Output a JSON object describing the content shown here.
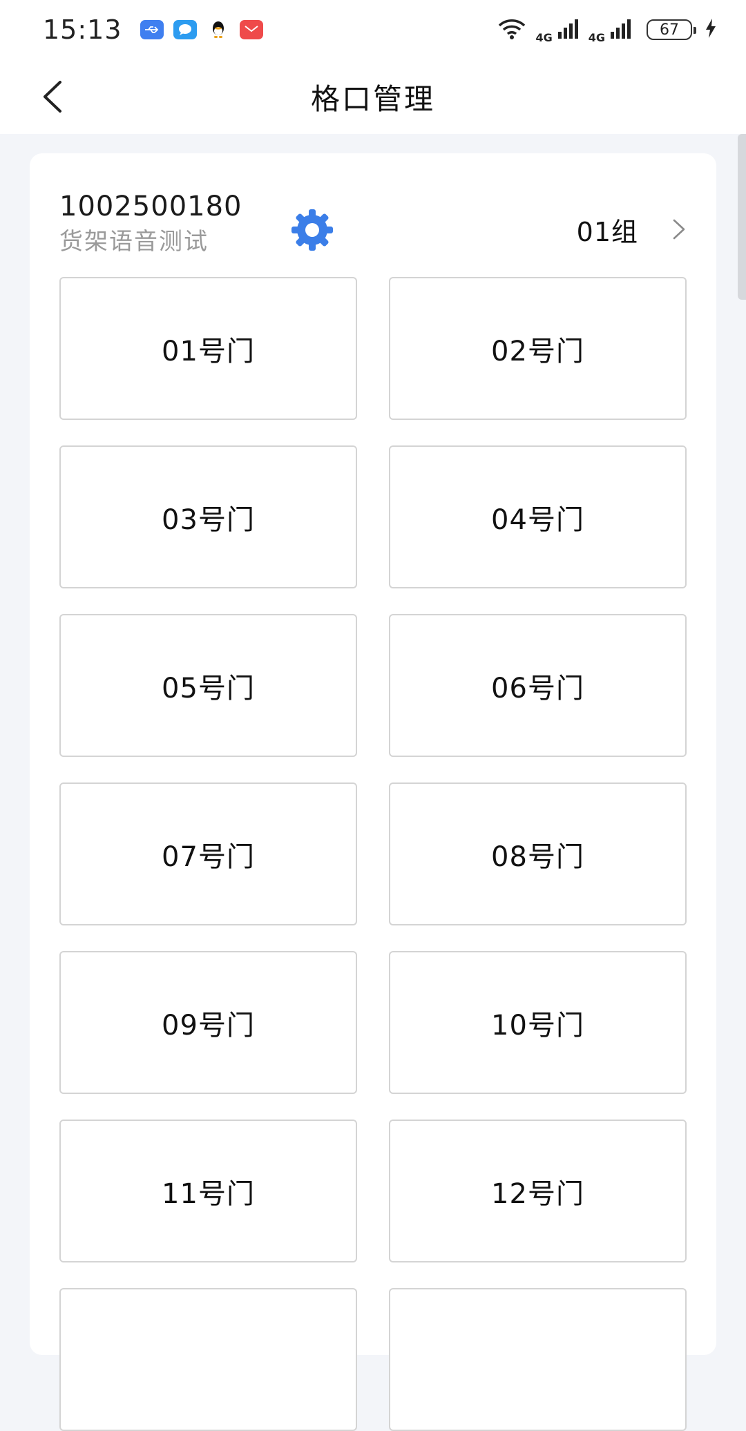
{
  "status_bar": {
    "time": "15:13",
    "notification_icons": [
      "usb-debug-icon",
      "message-icon",
      "qq-icon",
      "mail-icon"
    ],
    "signal_1_label": "4G",
    "signal_2_label": "4G",
    "battery_level": "67"
  },
  "header": {
    "title": "格口管理",
    "back_icon": "chevron-left-icon"
  },
  "device": {
    "id": "1002500180",
    "name": "货架语音测试",
    "settings_icon": "gear-icon",
    "group_label": "01组",
    "group_icon": "chevron-right-icon"
  },
  "doors": [
    {
      "label": "01号门"
    },
    {
      "label": "02号门"
    },
    {
      "label": "03号门"
    },
    {
      "label": "04号门"
    },
    {
      "label": "05号门"
    },
    {
      "label": "06号门"
    },
    {
      "label": "07号门"
    },
    {
      "label": "08号门"
    },
    {
      "label": "09号门"
    },
    {
      "label": "10号门"
    },
    {
      "label": "11号门"
    },
    {
      "label": "12号门"
    },
    {
      "label": ""
    },
    {
      "label": ""
    }
  ],
  "colors": {
    "accent": "#3b7ee8",
    "background": "#f3f5f9",
    "card": "#ffffff",
    "border": "#d4d4d4",
    "subtext": "#9a9a9a"
  }
}
